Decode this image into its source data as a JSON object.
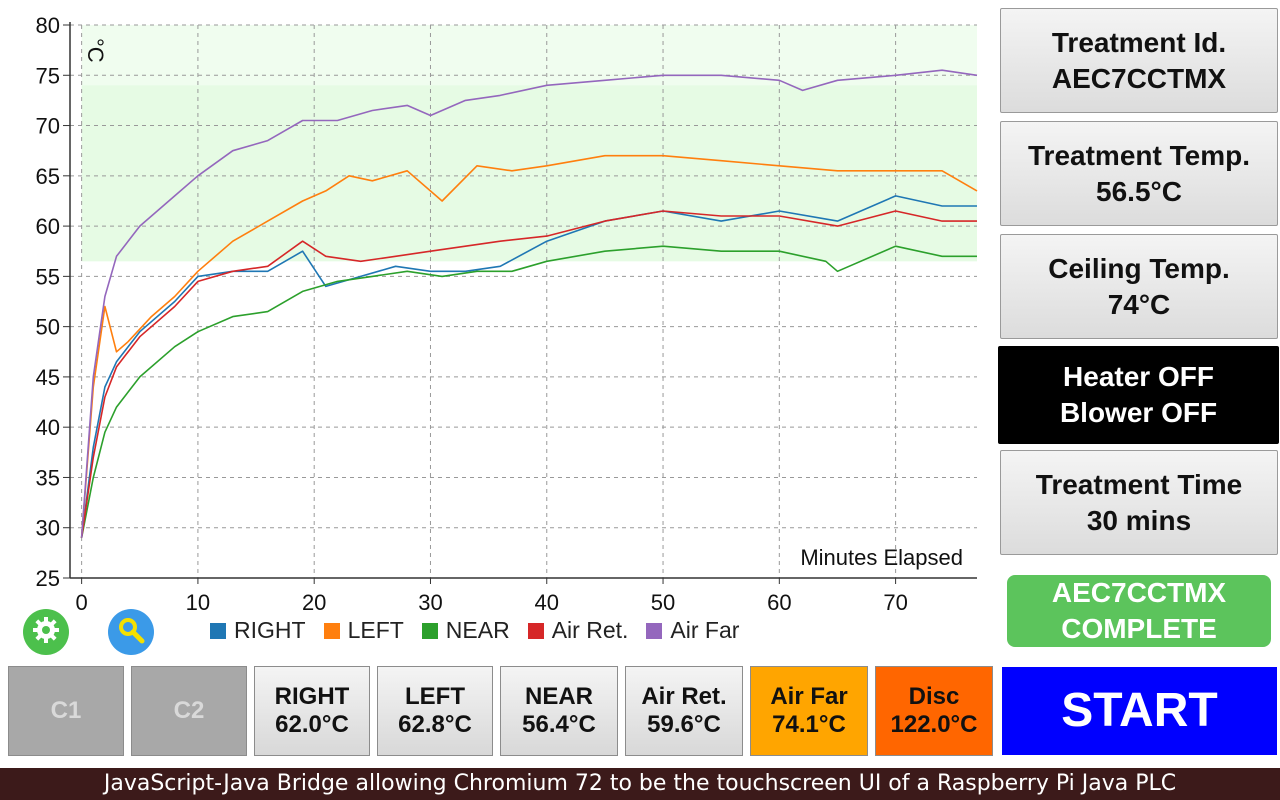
{
  "chart_data": {
    "type": "line",
    "ylabel": "°C",
    "xlabel": "Minutes Elapsed",
    "xlim": [
      -1,
      77
    ],
    "ylim": [
      25,
      80
    ],
    "xticks": [
      0,
      10,
      20,
      30,
      40,
      50,
      60,
      70
    ],
    "yticks": [
      25,
      30,
      35,
      40,
      45,
      50,
      55,
      60,
      65,
      70,
      75,
      80
    ],
    "band": [
      56.5,
      74
    ],
    "grid": true,
    "series": [
      {
        "name": "RIGHT",
        "color": "#1f77b4",
        "x": [
          0,
          1,
          2,
          3,
          5,
          8,
          10,
          13,
          16,
          19,
          21,
          24,
          27,
          30,
          33,
          36,
          40,
          45,
          50,
          55,
          60,
          65,
          70,
          74,
          77
        ],
        "y": [
          29,
          38,
          44,
          46.5,
          49.5,
          52.5,
          55,
          55.5,
          55.5,
          57.5,
          54,
          55,
          56,
          55.5,
          55.5,
          56,
          58.5,
          60.5,
          61.5,
          60.5,
          61.5,
          60.5,
          63,
          62,
          62
        ]
      },
      {
        "name": "LEFT",
        "color": "#ff7f0e",
        "x": [
          0,
          1,
          2,
          3,
          4,
          6,
          8,
          10,
          13,
          16,
          19,
          21,
          23,
          25,
          28,
          31,
          34,
          37,
          40,
          45,
          50,
          55,
          60,
          65,
          70,
          74,
          77
        ],
        "y": [
          29,
          44,
          52,
          47.5,
          48.5,
          51,
          53,
          55.5,
          58.5,
          60.5,
          62.5,
          63.5,
          65,
          64.5,
          65.5,
          62.5,
          66,
          65.5,
          66,
          67,
          67,
          66.5,
          66,
          65.5,
          65.5,
          65.5,
          63.5
        ]
      },
      {
        "name": "NEAR",
        "color": "#2ca02c",
        "x": [
          0,
          1,
          2,
          3,
          5,
          8,
          10,
          13,
          16,
          19,
          22,
          25,
          28,
          31,
          34,
          37,
          40,
          45,
          50,
          55,
          60,
          64,
          65,
          70,
          74,
          77
        ],
        "y": [
          29,
          35,
          39.5,
          42,
          45,
          48,
          49.5,
          51,
          51.5,
          53.5,
          54.5,
          55,
          55.5,
          55,
          55.5,
          55.5,
          56.5,
          57.5,
          58,
          57.5,
          57.5,
          56.5,
          55.5,
          58,
          57,
          57
        ]
      },
      {
        "name": "Air Ret.",
        "color": "#d62728",
        "x": [
          0,
          1,
          2,
          3,
          5,
          8,
          10,
          13,
          16,
          19,
          21,
          24,
          27,
          30,
          33,
          36,
          40,
          45,
          50,
          55,
          60,
          65,
          70,
          74,
          77
        ],
        "y": [
          29,
          37,
          43,
          46,
          49,
          52,
          54.5,
          55.5,
          56,
          58.5,
          57,
          56.5,
          57,
          57.5,
          58,
          58.5,
          59,
          60.5,
          61.5,
          61,
          61,
          60,
          61.5,
          60.5,
          60.5
        ]
      },
      {
        "name": "Air Far",
        "color": "#9467bd",
        "x": [
          0,
          1,
          2,
          3,
          5,
          8,
          10,
          13,
          16,
          19,
          22,
          25,
          28,
          30,
          33,
          36,
          40,
          45,
          50,
          55,
          60,
          62,
          65,
          70,
          74,
          77
        ],
        "y": [
          29,
          45,
          53,
          57,
          60,
          63,
          65,
          67.5,
          68.5,
          70.5,
          70.5,
          71.5,
          72,
          71,
          72.5,
          73,
          74,
          74.5,
          75,
          75,
          74.5,
          73.5,
          74.5,
          75,
          75.5,
          75
        ]
      }
    ]
  },
  "panels": {
    "treatment_id": {
      "label": "Treatment Id.",
      "value": "AEC7CCTMX"
    },
    "treatment_temp": {
      "label": "Treatment Temp.",
      "value": "56.5°C"
    },
    "ceiling_temp": {
      "label": "Ceiling Temp.",
      "value": "74°C"
    },
    "status": {
      "heater": "Heater OFF",
      "blower": "Blower OFF"
    },
    "treatment_time": {
      "label": "Treatment Time",
      "value": "30 mins"
    },
    "complete": {
      "id": "AEC7CCTMX",
      "text": "COMPLETE"
    }
  },
  "buttons": {
    "c1": "C1",
    "c2": "C2",
    "right": {
      "label": "RIGHT",
      "value": "62.0°C"
    },
    "left": {
      "label": "LEFT",
      "value": "62.8°C"
    },
    "near": {
      "label": "NEAR",
      "value": "56.4°C"
    },
    "air_ret": {
      "label": "Air Ret.",
      "value": "59.6°C"
    },
    "air_far": {
      "label": "Air Far",
      "value": "74.1°C"
    },
    "disc": {
      "label": "Disc",
      "value": "122.0°C"
    },
    "start": "START"
  },
  "icons": {
    "settings": "gear-icon",
    "zoom": "magnifier-icon"
  },
  "colors": {
    "settings_bg": "#4cc04c",
    "zoom_bg": "#3b9ae8",
    "band": "#e6fbe4"
  },
  "footer": "JavaScript-Java Bridge allowing Chromium 72 to be the touchscreen UI of a Raspberry Pi Java PLC"
}
